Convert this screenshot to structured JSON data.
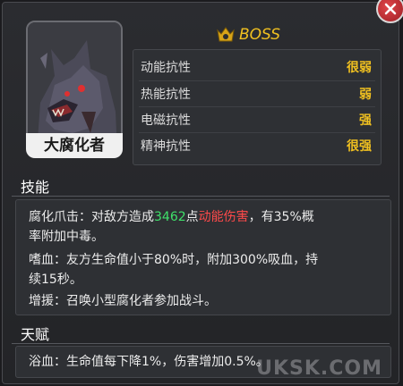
{
  "unit": {
    "name": "大腐化者",
    "rank": "BOSS"
  },
  "stats": [
    {
      "name": "动能抗性",
      "value": "很弱"
    },
    {
      "name": "热能抗性",
      "value": "弱"
    },
    {
      "name": "电磁抗性",
      "value": "强"
    },
    {
      "name": "精神抗性",
      "value": "很强"
    }
  ],
  "skills": {
    "title": "技能",
    "claw": {
      "prefix": "腐化爪击：对敌方造成",
      "damage_value": "3462",
      "mid": "点",
      "damage_type": "动能伤害",
      "suffix_line1": "，有35%概",
      "line2": "率附加中毒。"
    },
    "blood": {
      "line1": "嗜血：友方生命值小于80%时，附加300%吸血，持",
      "line2": "续15秒。"
    },
    "support": {
      "line1": "增援：召唤小型腐化者参加战斗。"
    }
  },
  "talent": {
    "title": "天赋",
    "line1": "浴血：生命值每下降1%，伤害增加0.5%。"
  },
  "watermark": "UKSK.COM",
  "colors": {
    "accent_gold": "#f0c020",
    "damage_green": "#3fe06a",
    "damage_red": "#ff4a4a"
  }
}
